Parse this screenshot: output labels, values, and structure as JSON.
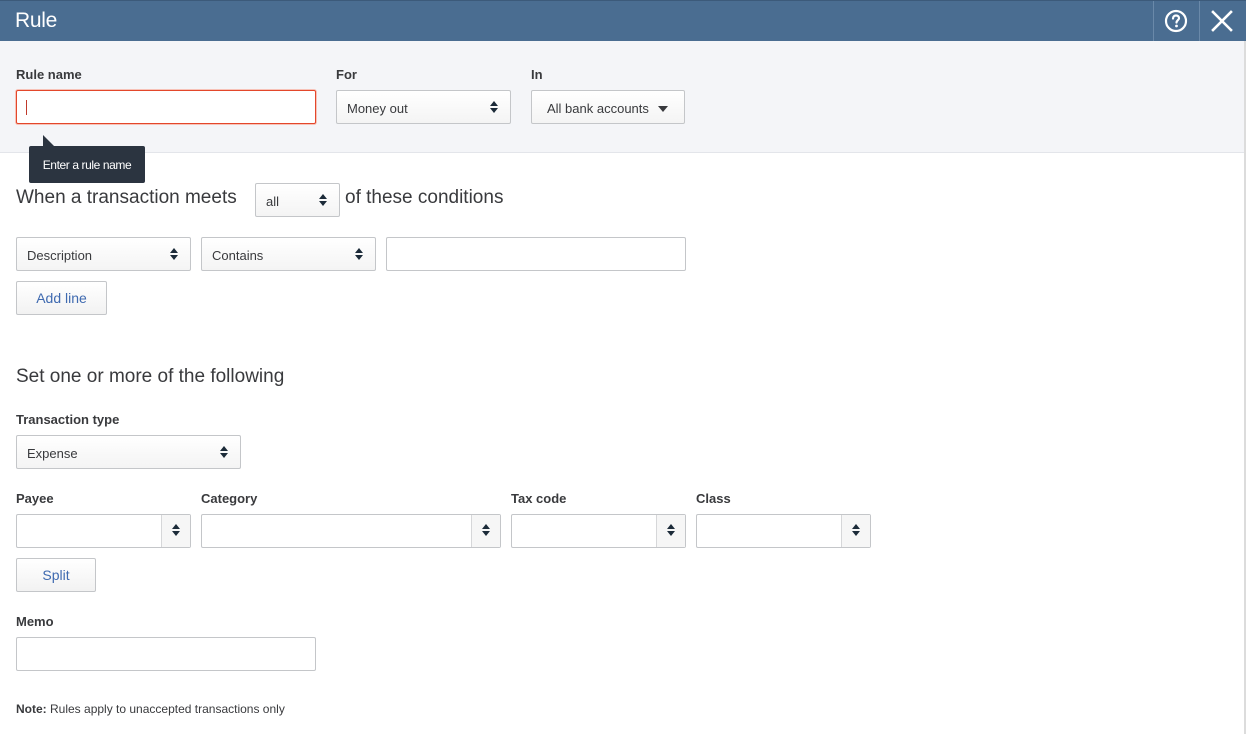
{
  "header": {
    "title": "Rule",
    "help_icon": "help-circle-icon",
    "close_icon": "close-icon",
    "background_color": "#4a6d91"
  },
  "top": {
    "rule_name": {
      "label": "Rule name",
      "value": "",
      "tooltip": "Enter a rule name"
    },
    "for": {
      "label": "For",
      "selected": "Money out"
    },
    "in": {
      "label": "In",
      "selected": "All bank accounts"
    }
  },
  "conditions": {
    "prefix": "When a transaction meets",
    "match_selected": "all",
    "suffix": "of these conditions",
    "lines": [
      {
        "field": "Description",
        "operator": "Contains",
        "value": ""
      }
    ],
    "add_line_label": "Add line"
  },
  "actions": {
    "heading": "Set one or more of the following",
    "transaction_type": {
      "label": "Transaction type",
      "selected": "Expense"
    },
    "payee": {
      "label": "Payee",
      "value": ""
    },
    "category": {
      "label": "Category",
      "value": ""
    },
    "tax_code": {
      "label": "Tax code",
      "value": ""
    },
    "class": {
      "label": "Class",
      "value": ""
    },
    "split_label": "Split",
    "memo": {
      "label": "Memo",
      "value": ""
    }
  },
  "note": {
    "bold": "Note:",
    "text": " Rules apply to unaccepted transactions only"
  },
  "colors": {
    "error_border": "#e3472b",
    "link_blue": "#3f6ab0",
    "tooltip_bg": "#2b3440"
  }
}
